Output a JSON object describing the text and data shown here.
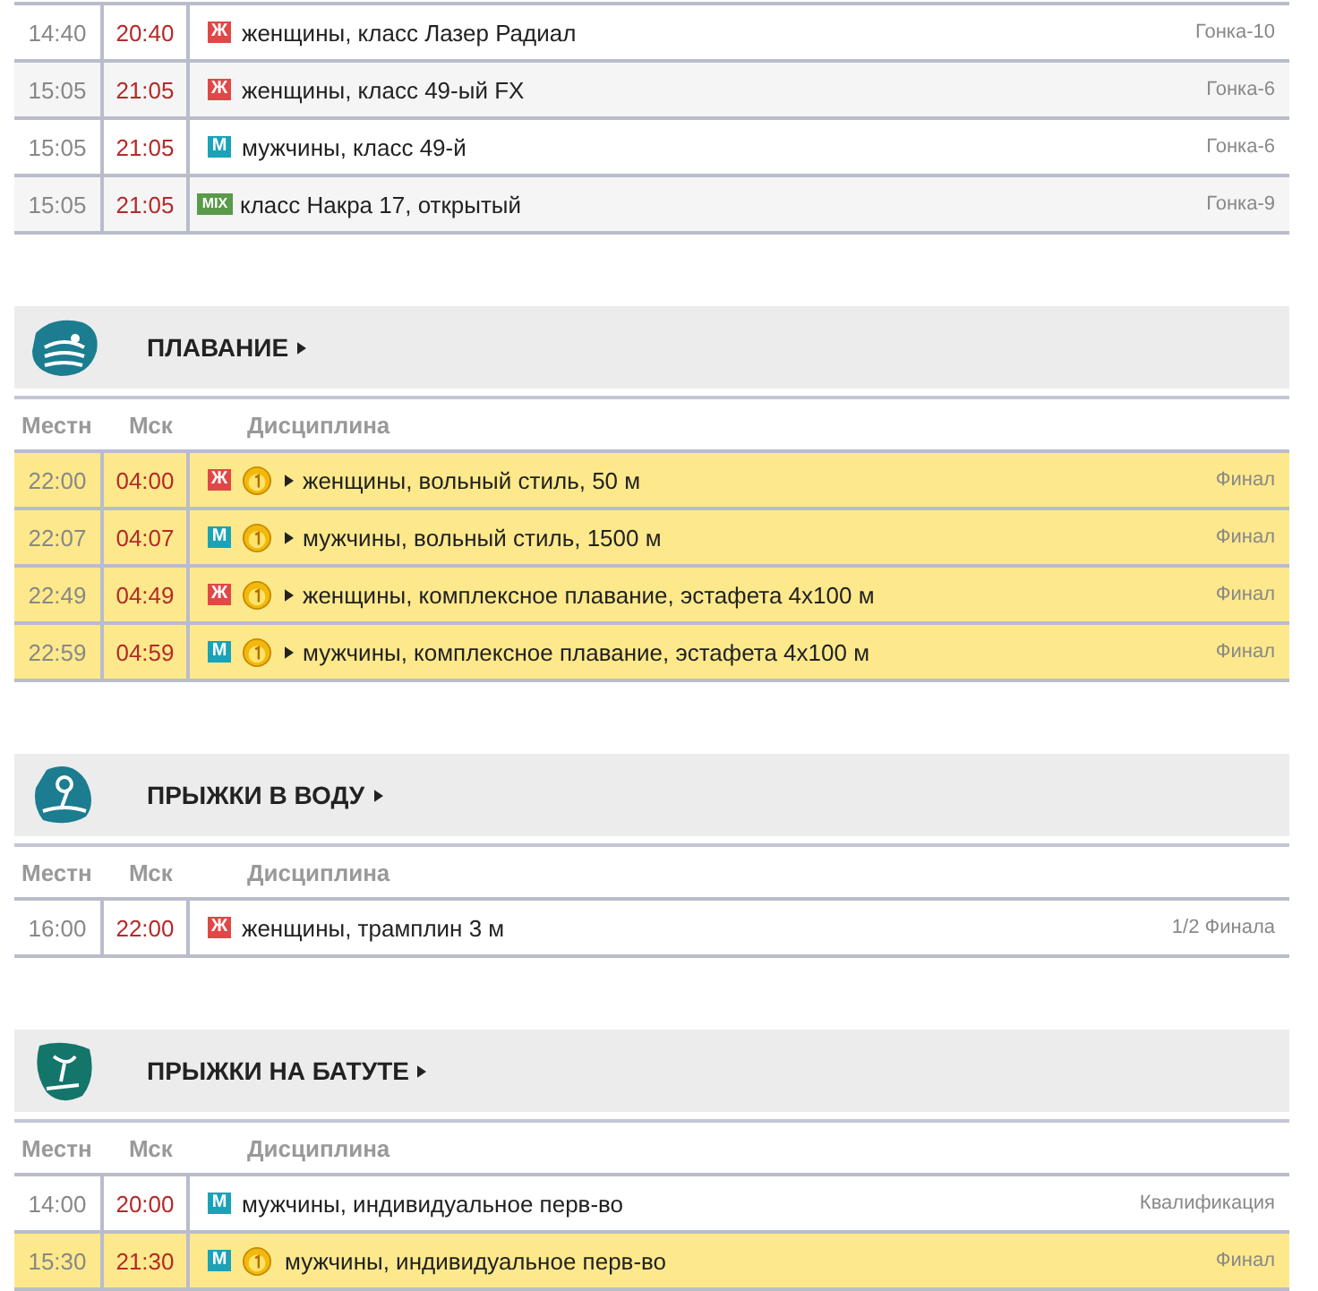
{
  "sections": [
    {
      "rows": [
        {
          "local": "14:40",
          "msk": "20:40",
          "kind": "w",
          "badge": "Ж",
          "medal": false,
          "expandable": false,
          "discipline": "женщины, класс Лазер Радиал",
          "stage": "Гонка-10"
        },
        {
          "local": "15:05",
          "msk": "21:05",
          "kind": "w",
          "badge": "Ж",
          "medal": false,
          "expandable": false,
          "discipline": "женщины, класс 49-ый FX",
          "stage": "Гонка-6"
        },
        {
          "local": "15:05",
          "msk": "21:05",
          "kind": "m",
          "badge": "М",
          "medal": false,
          "expandable": false,
          "discipline": "мужчины, класс 49-й",
          "stage": "Гонка-6"
        },
        {
          "local": "15:05",
          "msk": "21:05",
          "kind": "mix",
          "badge": "MIX",
          "medal": false,
          "expandable": false,
          "discipline": "класс Накра 17, открытый",
          "stage": "Гонка-9"
        }
      ]
    },
    {
      "title": "ПЛАВАНИЕ",
      "kind": "swimming",
      "headers": [
        "Местн",
        "Мск",
        "Дисциплина"
      ],
      "rows": [
        {
          "local": "22:00",
          "msk": "04:00",
          "kind": "w",
          "badge": "Ж",
          "medal": true,
          "expandable": true,
          "discipline": "женщины, вольный стиль, 50 м",
          "stage": "Финал"
        },
        {
          "local": "22:07",
          "msk": "04:07",
          "kind": "m",
          "badge": "М",
          "medal": true,
          "expandable": true,
          "discipline": "мужчины, вольный стиль, 1500 м",
          "stage": "Финал"
        },
        {
          "local": "22:49",
          "msk": "04:49",
          "kind": "w",
          "badge": "Ж",
          "medal": true,
          "expandable": true,
          "discipline": "женщины, комплексное плавание, эстафета 4x100 м",
          "stage": "Финал"
        },
        {
          "local": "22:59",
          "msk": "04:59",
          "kind": "m",
          "badge": "М",
          "medal": true,
          "expandable": true,
          "discipline": "мужчины, комплексное плавание, эстафета 4x100 м",
          "stage": "Финал"
        }
      ]
    },
    {
      "title": "ПРЫЖКИ В ВОДУ",
      "kind": "diving",
      "headers": [
        "Местн",
        "Мск",
        "Дисциплина"
      ],
      "rows": [
        {
          "local": "16:00",
          "msk": "22:00",
          "kind": "w",
          "badge": "Ж",
          "medal": false,
          "expandable": false,
          "discipline": "женщины, трамплин 3 м",
          "stage": "1/2 Финала"
        }
      ]
    },
    {
      "title": "ПРЫЖКИ НА БАТУТЕ",
      "kind": "trampoline",
      "headers": [
        "Местн",
        "Мск",
        "Дисциплина"
      ],
      "rows": [
        {
          "local": "14:00",
          "msk": "20:00",
          "kind": "m",
          "badge": "М",
          "medal": false,
          "expandable": false,
          "discipline": "мужчины, индивидуальное перв-во",
          "stage": "Квалификация"
        },
        {
          "local": "15:30",
          "msk": "21:30",
          "kind": "m",
          "badge": "М",
          "medal": true,
          "expandable": false,
          "discipline": "мужчины, индивидуальное перв-во",
          "stage": "Финал"
        }
      ]
    }
  ]
}
